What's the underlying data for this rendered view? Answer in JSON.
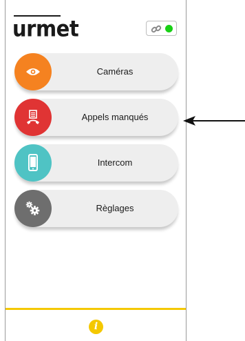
{
  "app": {
    "logo": "urmet"
  },
  "status": {
    "link_icon": "link-icon",
    "connected_color": "#18d015"
  },
  "menu": [
    {
      "label": "Caméras",
      "icon": "eye-icon",
      "color": "#f58220"
    },
    {
      "label": "Appels manqués",
      "icon": "missed-call-icon",
      "color": "#e03434"
    },
    {
      "label": "Intercom",
      "icon": "smartphone-icon",
      "color": "#4fc3c4"
    },
    {
      "label": "Règlages",
      "icon": "gear-icon",
      "color": "#6e6e6e"
    }
  ],
  "footer": {
    "info_icon": "info-icon",
    "info_glyph": "i",
    "accent": "#f4c800"
  }
}
